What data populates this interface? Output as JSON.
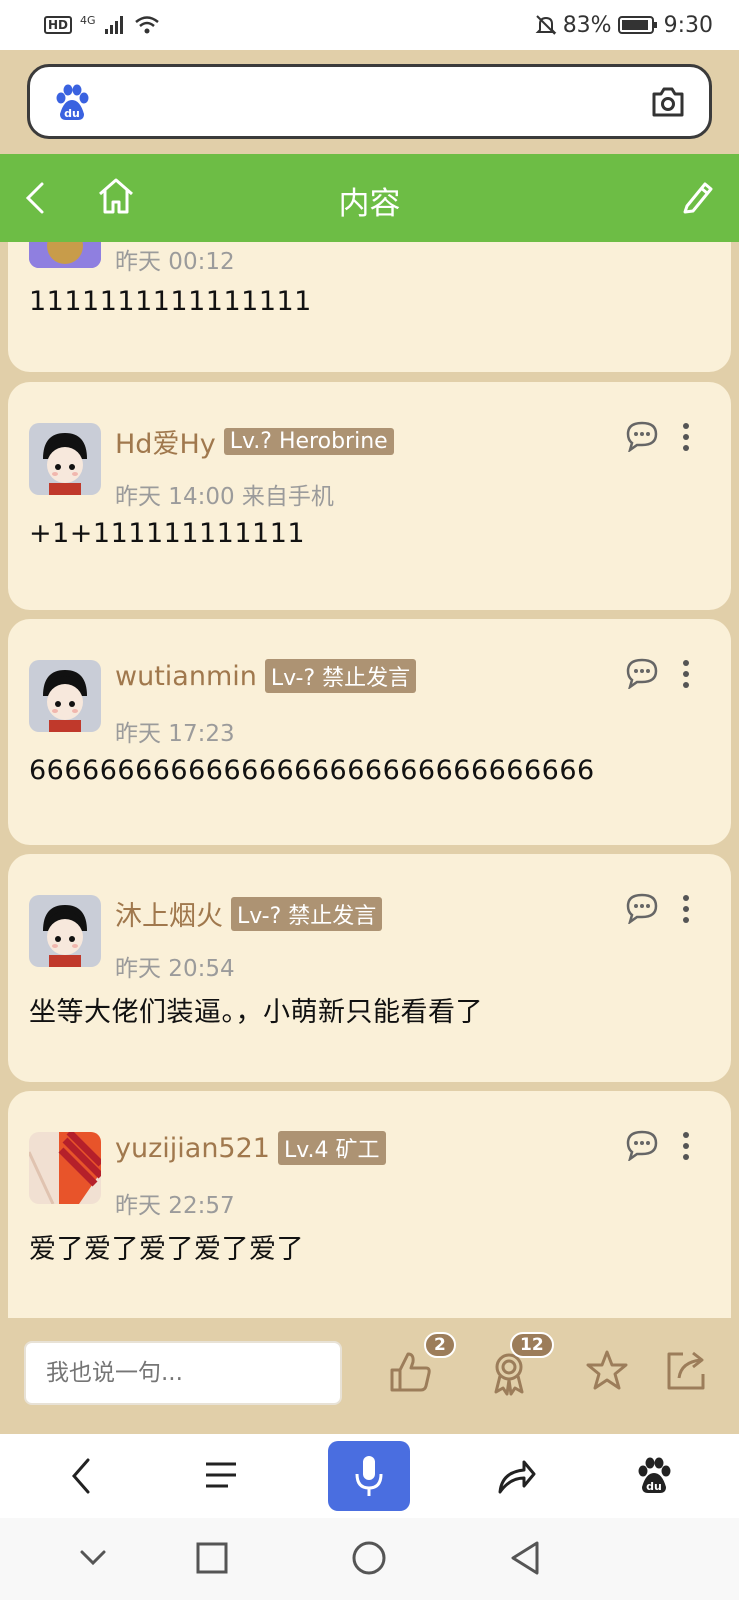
{
  "status": {
    "battery": "83%",
    "time": "9:30",
    "network": "4G",
    "hd": "HD"
  },
  "nav": {
    "title": "内容"
  },
  "posts": [
    {
      "time": "昨天 00:12",
      "text": "1111111111111111"
    },
    {
      "username": "Hd爱Hy",
      "badge": "Lv.? Herobrine",
      "time": "昨天 14:00 来自手机",
      "text": "+1+111111111111"
    },
    {
      "username": "wutianmin",
      "badge": "Lv-? 禁止发言",
      "time": "昨天 17:23",
      "text": "66666666666666666666666666666666"
    },
    {
      "username": "沐上烟火",
      "badge": "Lv-? 禁止发言",
      "time": "昨天 20:54",
      "text": "坐等大佬们装逼。，小萌新只能看看了"
    },
    {
      "username": "yuzijian521",
      "badge": "Lv.4 矿工",
      "time": "昨天 22:57",
      "text": "爱了爱了爱了爱了爱了"
    }
  ],
  "reply_bar": {
    "placeholder": "我也说一句...",
    "like_count": "2",
    "award_count": "12"
  },
  "icons": {
    "brand": "baidu-paw-icon",
    "accent_green": "#6dbd45",
    "bg_tan": "#e1cfa9",
    "card_bg": "#faf0d8",
    "mic_blue": "#4a6ee0"
  }
}
